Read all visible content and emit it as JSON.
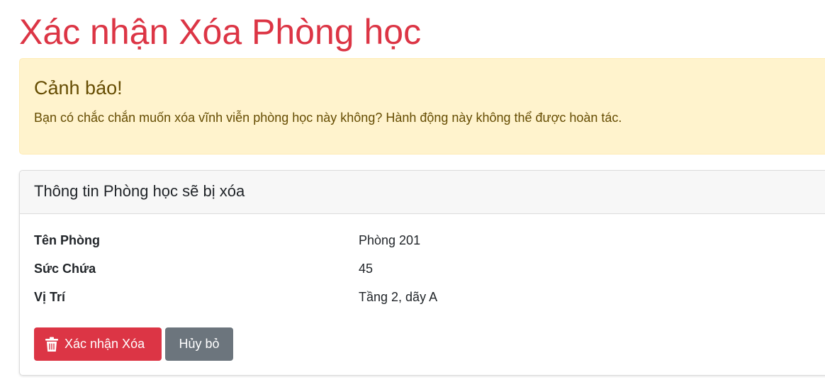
{
  "page": {
    "title": "Xác nhận Xóa Phòng học"
  },
  "alert": {
    "heading": "Cảnh báo!",
    "message": "Bạn có chắc chắn muốn xóa vĩnh viễn phòng học này không? Hành động này không thể được hoàn tác."
  },
  "card": {
    "title": "Thông tin Phòng học sẽ bị xóa",
    "rows": [
      {
        "label": "Tên Phòng",
        "value": "Phòng 201"
      },
      {
        "label": "Sức Chứa",
        "value": "45"
      },
      {
        "label": "Vị Trí",
        "value": "Tầng 2, dãy A"
      }
    ]
  },
  "actions": {
    "confirm_label": "Xác nhận Xóa",
    "confirm_icon": "trash-icon",
    "cancel_label": "Hủy bỏ"
  },
  "colors": {
    "danger": "#dc3545",
    "secondary": "#6c757d",
    "warning_bg": "#fff3cd",
    "warning_text": "#664d03"
  }
}
